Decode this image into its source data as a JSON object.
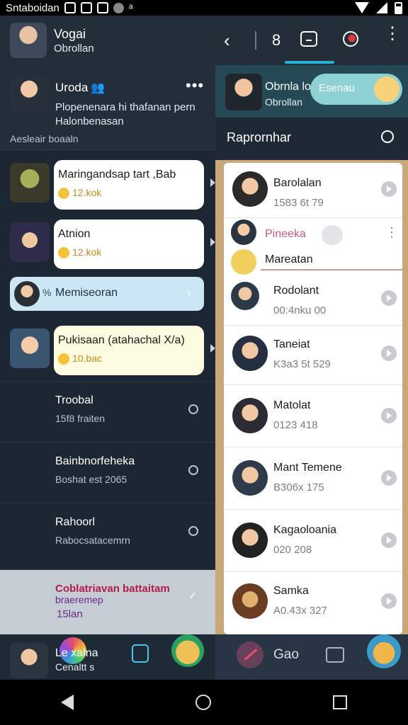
{
  "status_bar": {
    "carrier": "Sntaboidan",
    "extra": "ᵃ"
  },
  "header": {
    "title": "Vogai",
    "subtitle": "Obrollan",
    "count": "8"
  },
  "profile": {
    "name": "Uroda",
    "description": "Plopenenara hi thafanan pern Halonbenasan",
    "section": "Aesleair boaaln"
  },
  "chats_left": [
    {
      "title": "Maringandsap tart ,Bab",
      "meta": "12.kok"
    },
    {
      "title": "Atnion",
      "meta": "12.kok"
    },
    {
      "title": "Pukisaan (atahachal X/a)",
      "meta": "10.bac"
    }
  ],
  "pill": {
    "label": "Memiseoran"
  },
  "chats_plain": [
    {
      "title": "Troobal",
      "sub": "15f8 fraiten"
    },
    {
      "title": "Bainbnorfeheka",
      "sub": "Boshat est 2065"
    },
    {
      "title": "Rahoorl",
      "sub": "Rabocsatacemrn"
    },
    {
      "title": "Coblatriavan battaitam",
      "sub": "braeremep",
      "meta": "15lan"
    }
  ],
  "bottom_bar": {
    "name": "Le xalna",
    "sub": "Cenaltt s",
    "right_label": "Gao"
  },
  "right_panel": {
    "name": "Obrnla lo",
    "sub": "Obrollan",
    "badge": "Esenau",
    "section_title": "Raprornhar"
  },
  "right_list": [
    {
      "title": "Barolalan",
      "sub": "1583 6t 79"
    },
    {
      "title": "Rodolant",
      "sub": "00:4nku 00"
    },
    {
      "title": "Taneiat",
      "sub": "K3a3 5t 529"
    },
    {
      "title": "Matolat",
      "sub": "0123 418"
    },
    {
      "title": "Mant Temene",
      "sub": "B306x 175"
    },
    {
      "title": "Kagaoloania",
      "sub": "020 208"
    },
    {
      "title": "Samka",
      "sub": "A0.43x 327"
    }
  ],
  "right_pinned": {
    "title": "Pineeka",
    "sub": "Mareatan"
  }
}
